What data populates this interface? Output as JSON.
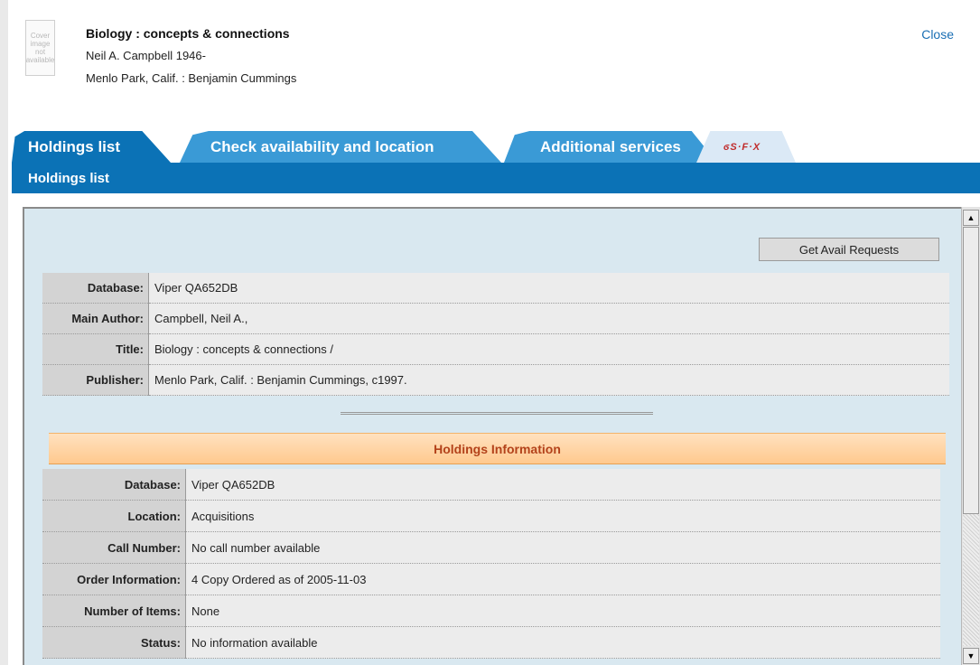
{
  "record": {
    "cover_text": "Cover image not available",
    "title": "Biology : concepts & connections",
    "author": "Neil A. Campbell 1946-",
    "publication": "Menlo Park, Calif. : Benjamin Cummings",
    "close_label": "Close"
  },
  "tabs": [
    {
      "label": "Holdings list",
      "active": true
    },
    {
      "label": "Check availability and location",
      "active": false
    },
    {
      "label": "Additional services",
      "active": false
    },
    {
      "label": "S·F·X",
      "active": false
    }
  ],
  "subbar": {
    "title": "Holdings list"
  },
  "panel": {
    "avail_button": "Get Avail Requests",
    "record_rows": [
      {
        "label": "Database:",
        "value": "Viper QA652DB"
      },
      {
        "label": "Main Author:",
        "value": "Campbell, Neil A.,"
      },
      {
        "label": "Title:",
        "value": "Biology :  concepts & connections /"
      },
      {
        "label": "Publisher:",
        "value": "Menlo Park, Calif. :  Benjamin Cummings,  c1997."
      }
    ],
    "holdings_header": "Holdings Information",
    "holdings_rows": [
      {
        "label": "Database:",
        "value": "Viper QA652DB"
      },
      {
        "label": "Location:",
        "value": "Acquisitions"
      },
      {
        "label": "Call Number:",
        "value": "No call number available"
      },
      {
        "label": "Order Information:",
        "value": "4 Copy Ordered as of 2005-11-03"
      },
      {
        "label": "Number of Items:",
        "value": "None"
      },
      {
        "label": "Status:",
        "value": "No information available"
      }
    ]
  },
  "colors": {
    "tab_active": "#0b72b6",
    "tab_inactive": "#3a9ad6",
    "panel_bg": "#d9e8f0",
    "holdings_header_text": "#b3421a"
  }
}
